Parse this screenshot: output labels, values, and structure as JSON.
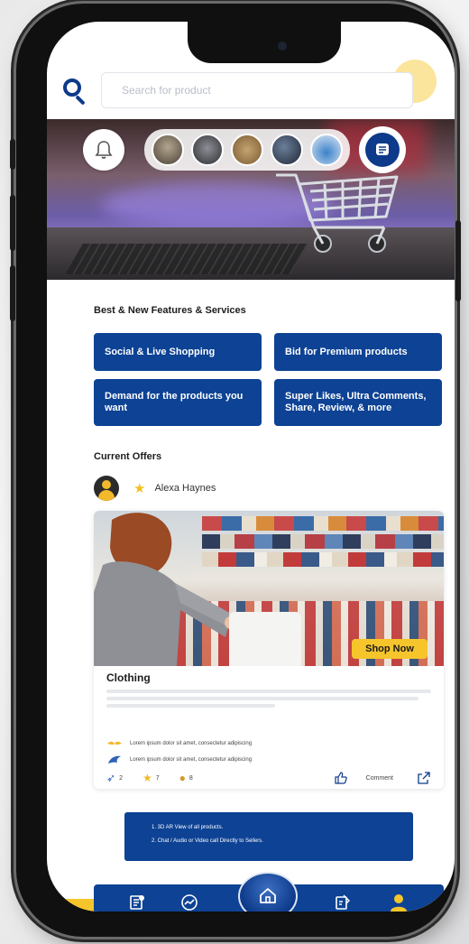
{
  "search": {
    "placeholder": "Search for product"
  },
  "sections": {
    "features_title": "Best & New Features & Services",
    "offers_title": "Current Offers"
  },
  "features": [
    {
      "label": "Social & Live Shopping"
    },
    {
      "label": "Bid for Premium products"
    },
    {
      "label": "Demand for the products you want"
    },
    {
      "label": "Super Likes, Ultra Comments, Share, Review, & more"
    }
  ],
  "offer": {
    "username": "Alexa Haynes",
    "shop_now_label": "Shop Now",
    "title": "Clothing",
    "bullets": [
      {
        "icon": "wings-icon",
        "text": "Lorem ipsum dolor sit amet, consectetur adipiscing"
      },
      {
        "icon": "bird-icon",
        "text": "Lorem ipsum dolor sit amet, consectetur adipiscing"
      }
    ],
    "stats": [
      {
        "icon": "bird-icon",
        "count": "2"
      },
      {
        "icon": "star-icon",
        "count": "7"
      },
      {
        "icon": "coin-icon",
        "count": "8"
      }
    ],
    "comment_label": "Comment"
  },
  "info_box": {
    "lines": [
      "1. 3D AR View of all products.",
      "2. Chat / Audio or Video call Directly to Sellers."
    ]
  },
  "colors": {
    "primary": "#0d4294",
    "accent": "#f6c52b"
  },
  "nav": {
    "items": [
      {
        "icon": "catalog-icon"
      },
      {
        "icon": "trend-icon"
      },
      {
        "icon": "home-icon"
      },
      {
        "icon": "orders-icon"
      },
      {
        "icon": "profile-icon"
      }
    ]
  }
}
